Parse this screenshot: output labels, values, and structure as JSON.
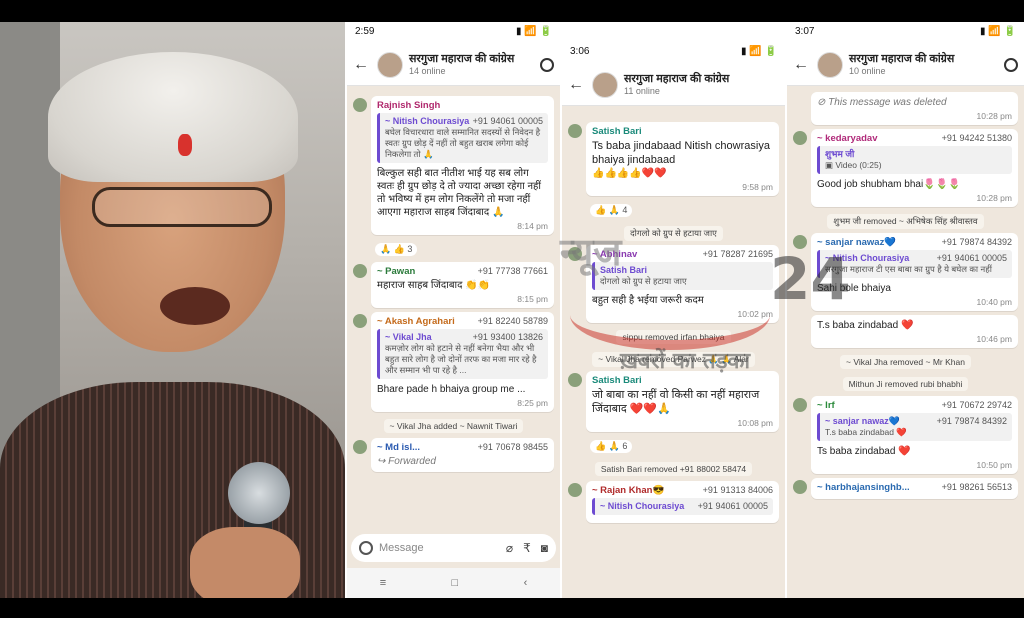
{
  "phone1": {
    "status_time": "2:59",
    "group_name": "सरगुजा महाराज की कांग्रेस",
    "members_online": "14 online",
    "messages": [
      {
        "sender": "Rajnish Singh",
        "quote_name": "~ Nitish Chourasiya",
        "quote_phone": "+91 94061 00005",
        "quote_text": "बघेल विचारधारा वाले सम्मानित सदस्यों से निवेदन है स्वतः ग्रुप छोड़ दें नहीं तो बहुत खराब लगेगा कोई निकलेगा तो 🙏",
        "text": "बिल्कुल सही बात नीतीश भाई यह सब लोग स्वतः ही ग्रुप छोड़ दे तो ज्यादा अच्छा रहेगा नहीं तो भविष्य में हम लोग निकलेंगे तो मजा नहीं आएगा महाराज साहब जिंदाबाद 🙏",
        "time": "8:14 pm",
        "reaction": "🙏 👍 3"
      },
      {
        "sender": "~ Pawan",
        "phone": "+91 77738 77661",
        "text": "महाराज साहब जिंदाबाद 👏👏",
        "time": "8:15 pm"
      },
      {
        "sender": "~ Akash Agrahari",
        "phone": "+91 82240 58789",
        "quote_name": "~ Vikal Jha",
        "quote_phone": "+91 93400 13826",
        "quote_text": "कमज़ोर लोग को हटाने से नहीं बनेगा भैया और भी बहुत सारे लोग है जो दोनों तरफ का मजा मार रहे है और सम्मान भी पा रहे है ...",
        "text": "Bhare pade h bhaiya group me ...",
        "time": "8:25 pm"
      },
      {
        "sender": "~ Md isl...",
        "phone": "+91 70678 98455",
        "text": "Forwarded"
      }
    ],
    "system": [
      "~ Vikal Jha added ~ Nawnit Tiwari"
    ],
    "input_placeholder": "Message"
  },
  "phone2": {
    "status_time": "3:06",
    "group_name": "सरगुजा महाराज की कांग्रेस",
    "members_online": "11 online",
    "messages": [
      {
        "sender": "Satish Bari",
        "text": "Ts baba jindabaad Nitish chowrasiya bhaiya jindabaad",
        "emoji": "👍👍👍👍❤️❤️",
        "time": "9:58 pm",
        "reaction": "👍 🙏 4"
      },
      {
        "sender": "~ Abhinav",
        "phone": "+91 78287 21695",
        "quote_name": "Satish Bari",
        "quote_text": "दोगलो को ग्रुप से हटाया जाए",
        "text": "बहुत सही है भईया जरूरी कदम",
        "time": "10:02 pm"
      },
      {
        "sender": "Satish Bari",
        "text": "जो बाबा का नहीं वो किसी का नहीं महाराज जिंदाबाद ❤️❤️🙏",
        "time": "10:08 pm",
        "reaction": "👍 🙏 6"
      },
      {
        "sender": "~ Rajan Khan😎",
        "phone": "+91 91313 84006",
        "quote_name": "~ Nitish Chourasiya",
        "quote_phone": "+91 94061 00005"
      }
    ],
    "system": [
      "दोगलो को ग्रुप से हटाया जाए",
      "sippu removed irfan bhaiya",
      "~ Vikal Jha removed Parwez 🙏 🙏 Alar",
      "Satish Bari removed +91 88002 58474"
    ]
  },
  "phone3": {
    "status_time": "3:07",
    "group_name": "सरगुजा महाराज की कांग्रेस",
    "members_online": "10 online",
    "messages": [
      {
        "sender": "",
        "text": "This message was deleted",
        "time": "10:28 pm"
      },
      {
        "sender": "~ kedaryadav",
        "phone": "+91 94242 51380",
        "quote_name": "शुभम जी",
        "quote_text": "Video (0:25)",
        "text": "Good job shubham bhai🌷🌷🌷",
        "time": "10:28 pm"
      },
      {
        "sender": "~ sanjar nawaz💙",
        "phone": "+91 79874 84392",
        "quote_name": "~ Nitish Chourasiya",
        "quote_phone": "+91 94061 00005",
        "quote_text": "सरगुजा महाराज टी एस बाबा का ग्रुप है ये बघेल का नहीं",
        "text": "Sahi bole bhaiya",
        "time": "10:40 pm"
      },
      {
        "sender": "",
        "text": "T.s baba zindabad ❤️",
        "time": "10:46 pm"
      },
      {
        "sender": "~ Irf",
        "phone": "+91 70672 29742",
        "quote_name": "~ sanjar nawaz💙",
        "quote_phone": "+91 79874 84392",
        "quote_text": "T.s baba zindabad ❤️",
        "text": "Ts baba zindabad ❤️",
        "time": "10:50 pm"
      },
      {
        "sender": "~ harbhajansinghb...",
        "phone": "+91 98261 56513"
      }
    ],
    "system": [
      "शुभम जी removed ~ अभिषेक सिंह श्रीवास्तव",
      "~ Vikal Jha removed ~ Mr Khan",
      "Mithun Ji removed rubi bhabhi"
    ]
  },
  "watermark": {
    "title": "न्यूज",
    "num": "24",
    "sub": "ख़बरों का तड़का"
  }
}
